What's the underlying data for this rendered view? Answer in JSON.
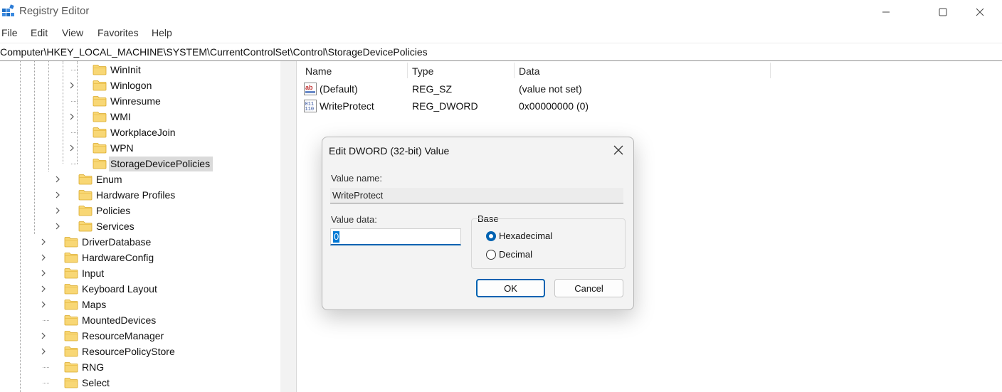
{
  "window": {
    "title": "Registry Editor"
  },
  "menu": [
    "File",
    "Edit",
    "View",
    "Favorites",
    "Help"
  ],
  "address": "Computer\\HKEY_LOCAL_MACHINE\\SYSTEM\\CurrentControlSet\\Control\\StorageDevicePolicies",
  "tree": {
    "items": [
      {
        "label": "WinInit",
        "expandable": false,
        "selected": false
      },
      {
        "label": "Winlogon",
        "expandable": true,
        "selected": false
      },
      {
        "label": "Winresume",
        "expandable": false,
        "selected": false
      },
      {
        "label": "WMI",
        "expandable": true,
        "selected": false
      },
      {
        "label": "WorkplaceJoin",
        "expandable": false,
        "selected": false
      },
      {
        "label": "WPN",
        "expandable": true,
        "selected": false
      },
      {
        "label": "StorageDevicePolicies",
        "expandable": false,
        "selected": true
      },
      {
        "label": "Enum",
        "expandable": true,
        "selected": false
      },
      {
        "label": "Hardware Profiles",
        "expandable": true,
        "selected": false
      },
      {
        "label": "Policies",
        "expandable": true,
        "selected": false
      },
      {
        "label": "Services",
        "expandable": true,
        "selected": false
      },
      {
        "label": "DriverDatabase",
        "expandable": true,
        "selected": false
      },
      {
        "label": "HardwareConfig",
        "expandable": true,
        "selected": false
      },
      {
        "label": "Input",
        "expandable": true,
        "selected": false
      },
      {
        "label": "Keyboard Layout",
        "expandable": true,
        "selected": false
      },
      {
        "label": "Maps",
        "expandable": true,
        "selected": false
      },
      {
        "label": "MountedDevices",
        "expandable": false,
        "selected": false
      },
      {
        "label": "ResourceManager",
        "expandable": true,
        "selected": false
      },
      {
        "label": "ResourcePolicyStore",
        "expandable": true,
        "selected": false
      },
      {
        "label": "RNG",
        "expandable": false,
        "selected": false
      },
      {
        "label": "Select",
        "expandable": false,
        "selected": false
      }
    ]
  },
  "list": {
    "columns": [
      "Name",
      "Type",
      "Data"
    ],
    "rows": [
      {
        "icon": "string-value-icon",
        "name": "(Default)",
        "type": "REG_SZ",
        "data": "(value not set)"
      },
      {
        "icon": "binary-value-icon",
        "name": "WriteProtect",
        "type": "REG_DWORD",
        "data": "0x00000000 (0)"
      }
    ]
  },
  "dialog": {
    "title": "Edit DWORD (32-bit) Value",
    "value_name_label": "Value name:",
    "value_name": "WriteProtect",
    "value_data_label": "Value data:",
    "value_data": "0",
    "base_label": "Base",
    "base_options": [
      "Hexadecimal",
      "Decimal"
    ],
    "base_selected": "Hexadecimal",
    "ok_label": "OK",
    "cancel_label": "Cancel"
  },
  "colors": {
    "accent": "#0062b1",
    "folder": "#f8d775",
    "selection": "#dadada"
  }
}
